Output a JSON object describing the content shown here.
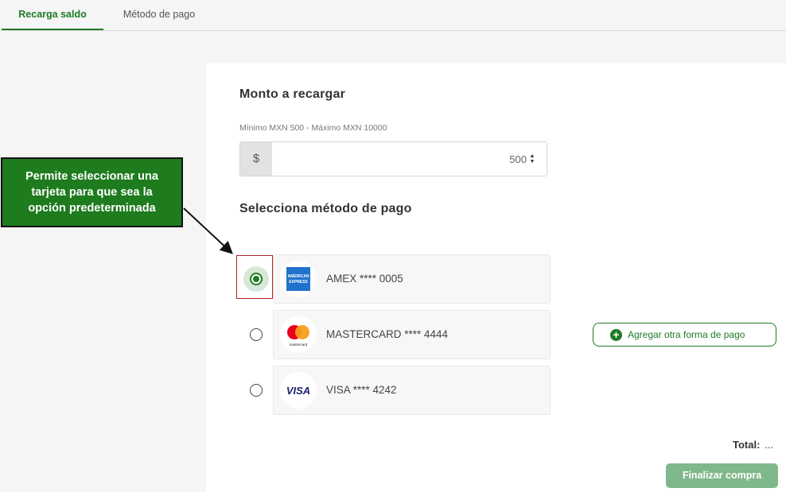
{
  "tabs": [
    {
      "label": "Recarga saldo",
      "active": true
    },
    {
      "label": "Método de pago",
      "active": false
    }
  ],
  "amount": {
    "title": "Monto a recargar",
    "hint": "Mínimo MXN 500 - Máximo MXN 10000",
    "currency_symbol": "$",
    "value": "500"
  },
  "payment": {
    "title": "Selecciona método de pago",
    "cards": [
      {
        "label": "AMEX **** 0005",
        "icon": "amex-logo-icon",
        "selected": true
      },
      {
        "label": "MASTERCARD **** 4444",
        "icon": "mastercard-logo-icon",
        "selected": false
      },
      {
        "label": "VISA **** 4242",
        "icon": "visa-logo-icon",
        "selected": false
      }
    ],
    "add_button": "Agregar otra forma de pago"
  },
  "total": {
    "label": "Total:",
    "value": "..."
  },
  "finish_button": "Finalizar compra",
  "callout": {
    "text": "Permite seleccionar una tarjeta para que sea la opción predeterminada"
  },
  "logos": {
    "amex_text": "AMERICAN EXPRESS",
    "mastercard_text": "mastercard",
    "visa_text": "VISA"
  },
  "colors": {
    "accent": "#1f7a26",
    "callout_bg": "#1e7b1e",
    "highlight": "#b22222",
    "button_disabled": "#7fb88a"
  }
}
